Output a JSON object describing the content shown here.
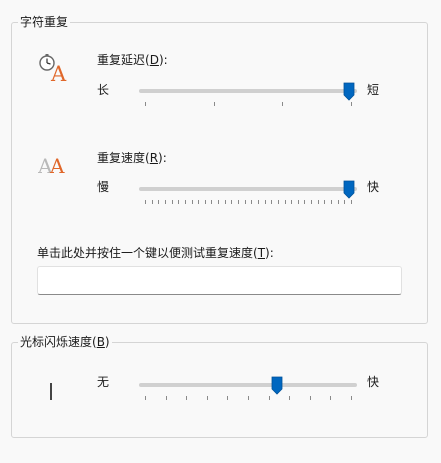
{
  "keyboard": {
    "group_title": "字符重复",
    "repeat_delay": {
      "label_prefix": "重复延迟(",
      "mnemonic": "D",
      "label_suffix": "):",
      "min_label": "长",
      "max_label": "短",
      "value_fraction": 0.99
    },
    "repeat_rate": {
      "label_prefix": "重复速度(",
      "mnemonic": "R",
      "label_suffix": "):",
      "min_label": "慢",
      "max_label": "快",
      "value_fraction": 0.99
    },
    "test_label_prefix": "单击此处并按住一个键以便测试重复速度(",
    "test_mnemonic": "T",
    "test_label_suffix": "):",
    "test_value": ""
  },
  "cursor": {
    "group_title_prefix": "光标闪烁速度(",
    "mnemonic": "B",
    "group_title_suffix": ")",
    "min_label": "无",
    "max_label": "快",
    "value_fraction": 0.64
  },
  "colors": {
    "accent": "#0067c0",
    "icon_orange": "#e0672a",
    "icon_gray": "#b9b9b9"
  },
  "icons": [
    "clock-a-icon",
    "double-a-icon",
    "text-cursor-icon"
  ]
}
